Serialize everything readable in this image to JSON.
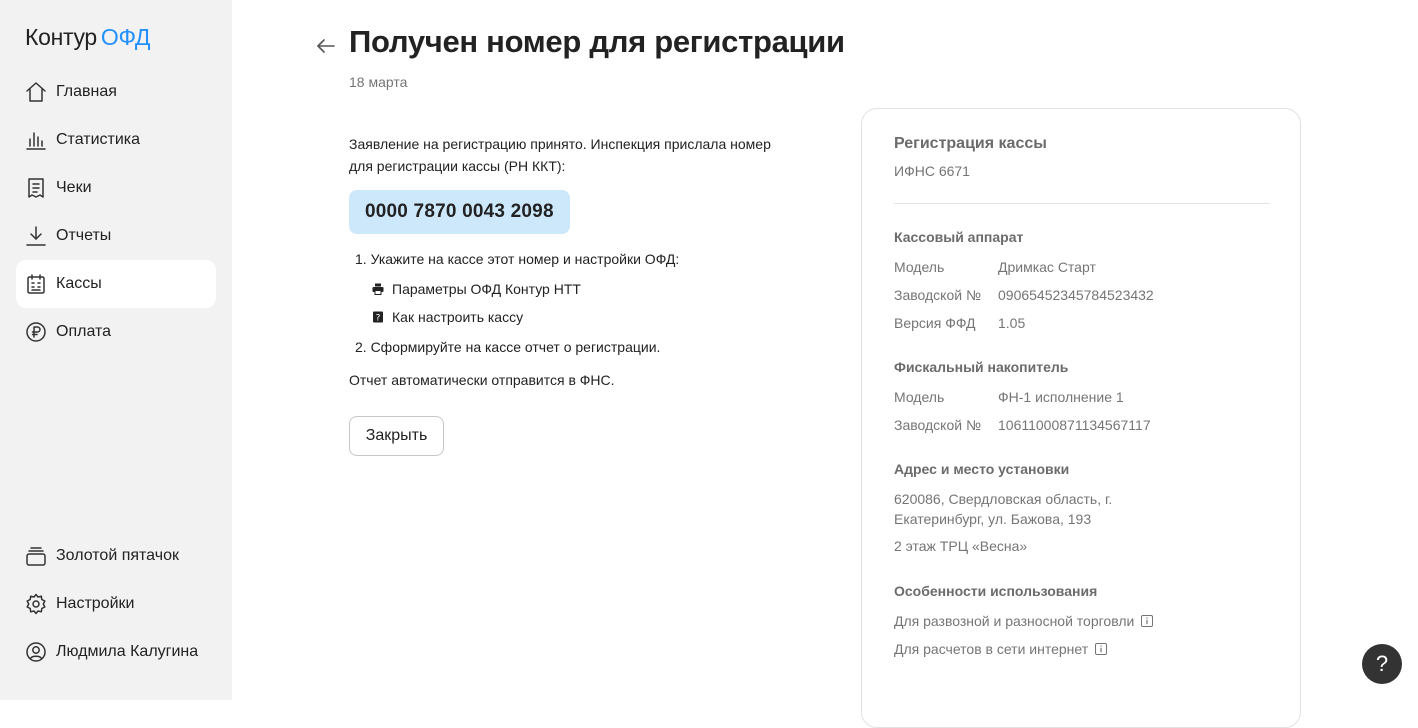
{
  "app": {
    "logo_main": "Контур",
    "logo_accent": "ОФД"
  },
  "sidebar": {
    "top_items": [
      {
        "label": "Главная",
        "icon": "home-icon"
      },
      {
        "label": "Статистика",
        "icon": "chart-icon"
      },
      {
        "label": "Чеки",
        "icon": "receipt-icon"
      },
      {
        "label": "Отчеты",
        "icon": "download-icon"
      },
      {
        "label": "Кассы",
        "icon": "cash-register-icon",
        "active": true
      },
      {
        "label": "Оплата",
        "icon": "ruble-icon"
      }
    ],
    "bottom_items": [
      {
        "label": "Золотой пятачок",
        "icon": "coins-icon"
      },
      {
        "label": "Настройки",
        "icon": "gear-icon"
      },
      {
        "label": "Людмила Калугина",
        "icon": "user-icon"
      }
    ]
  },
  "main": {
    "title": "Получен номер для регистрации",
    "date": "18 марта",
    "intro": "Заявление на регистрацию принято. Инспекция прислала номер для регистрации кассы (РН ККТ):",
    "reg_number": "0000 7870 0043 2098",
    "step1": "1. Укажите на кассе этот номер и настройки ОФД:",
    "step1_links": [
      {
        "label": "Параметры ОФД Контур НТТ",
        "icon": "printer-icon"
      },
      {
        "label": "Как настроить кассу",
        "icon": "help-doc-icon"
      }
    ],
    "step2": "2. Сформируйте на кассе отчет о регистрации.",
    "auto_note": "Отчет автоматически отправится в ФНС.",
    "close_label": "Закрыть"
  },
  "card": {
    "title": "Регистрация кассы",
    "subtitle": "ИФНС 6671",
    "register": {
      "title": "Кассовый аппарат",
      "rows": [
        {
          "key": "Модель",
          "value": "Дримкас Старт"
        },
        {
          "key": "Заводской №",
          "value": "09065452345784523432"
        },
        {
          "key": "Версия ФФД",
          "value": "1.05"
        }
      ]
    },
    "fiscal": {
      "title": "Фискальный накопитель",
      "rows": [
        {
          "key": "Модель",
          "value": "ФН-1 исполнение 1"
        },
        {
          "key": "Заводской №",
          "value": "1061100087113456​7117"
        }
      ]
    },
    "address": {
      "title": "Адрес и место установки",
      "line": "620086, Свердловская область, г. Екатеринбург, ул. Бажова, 193",
      "place": "2 этаж ТРЦ «Весна»"
    },
    "features": {
      "title": "Особенности использования",
      "items": [
        "Для развозной и разносной торговли",
        "Для расчетов в сети интернет"
      ]
    }
  },
  "help": {
    "label": "?"
  },
  "colors": {
    "accent": "#2291ff",
    "sidebar_bg": "#f2f2f2",
    "regnum_bg": "#cde8fb"
  }
}
